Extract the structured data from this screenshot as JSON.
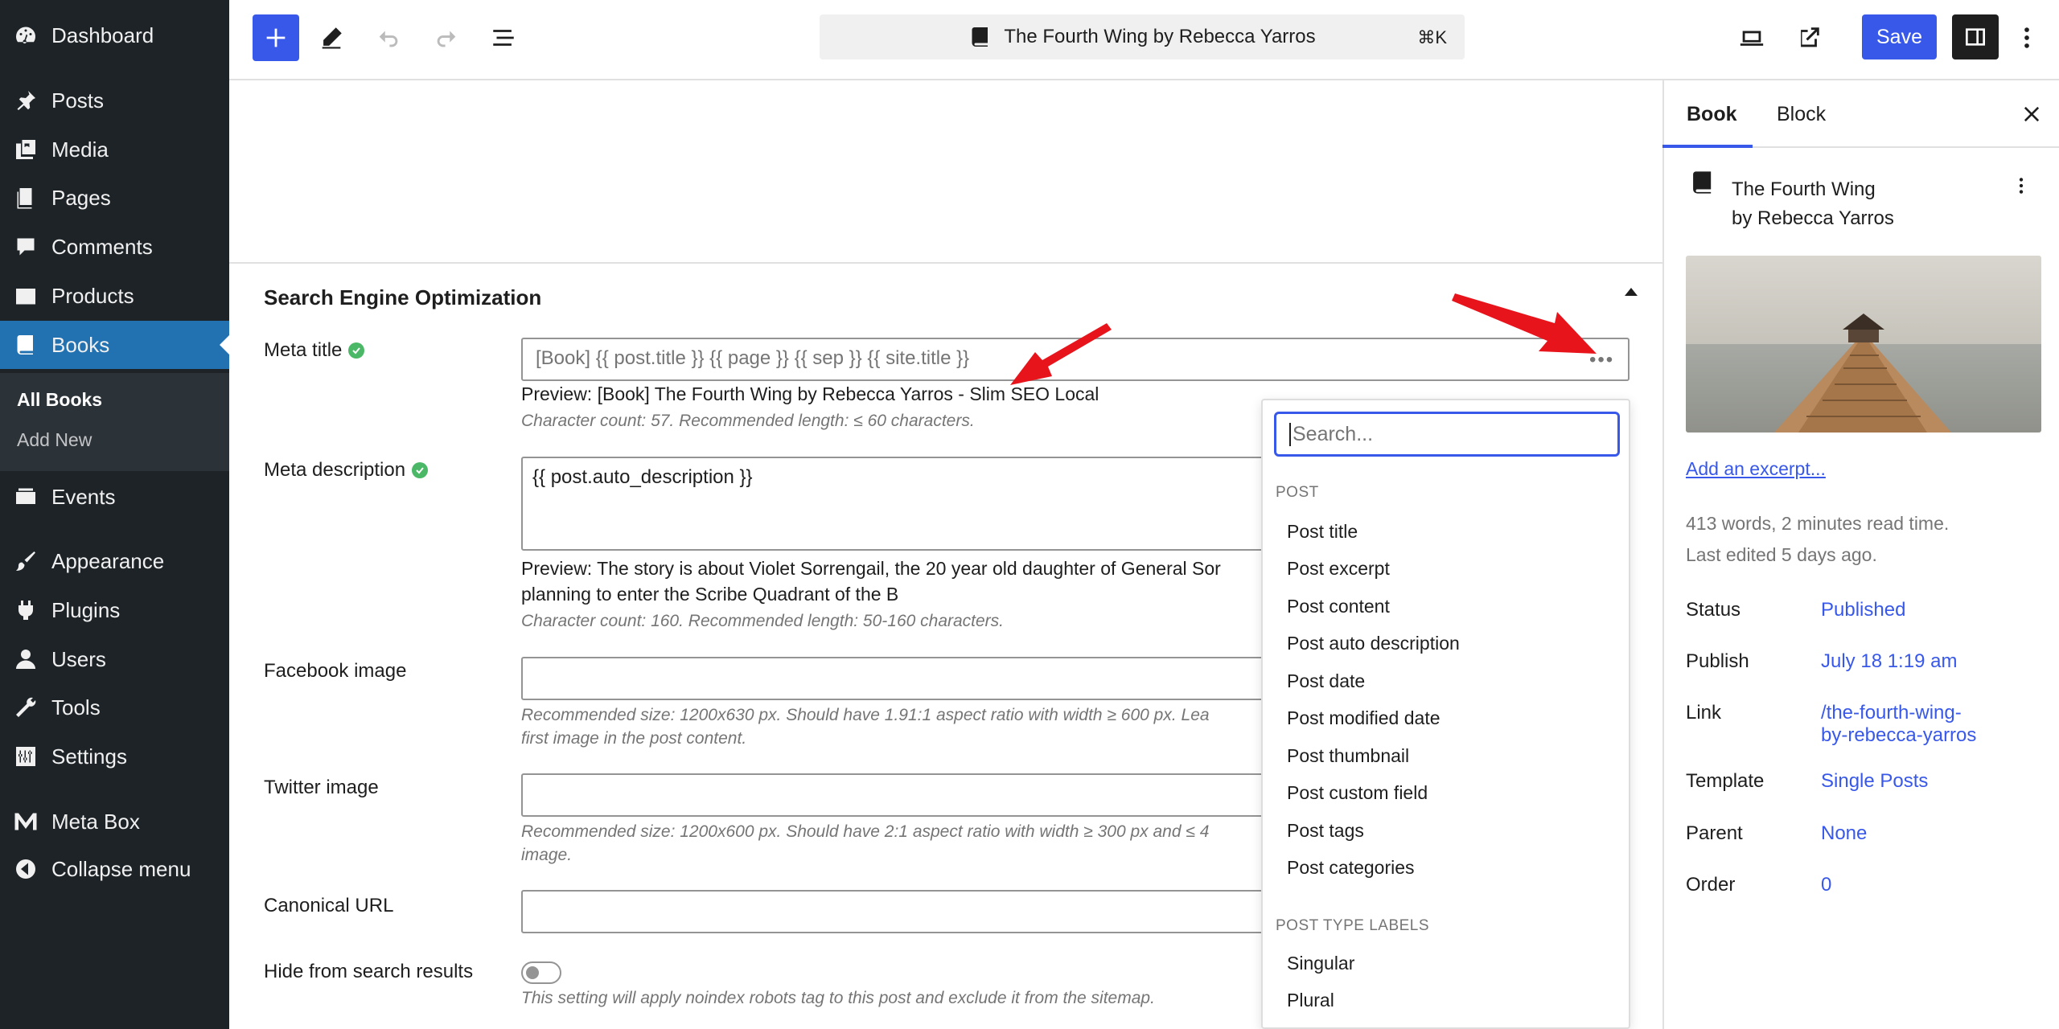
{
  "admin_menu": {
    "items": [
      {
        "label": "Dashboard"
      },
      {
        "label": "Posts"
      },
      {
        "label": "Media"
      },
      {
        "label": "Pages"
      },
      {
        "label": "Comments"
      },
      {
        "label": "Products"
      },
      {
        "label": "Books"
      },
      {
        "label": "Events"
      },
      {
        "label": "Appearance"
      },
      {
        "label": "Plugins"
      },
      {
        "label": "Users"
      },
      {
        "label": "Tools"
      },
      {
        "label": "Settings"
      },
      {
        "label": "Meta Box"
      },
      {
        "label": "Collapse menu"
      }
    ],
    "submenu": [
      {
        "label": "All Books"
      },
      {
        "label": "Add New"
      }
    ]
  },
  "toolbar": {
    "document_title": "The Fourth Wing by Rebecca Yarros",
    "shortcut": "⌘K",
    "save_label": "Save"
  },
  "seo": {
    "section_title": "Search Engine Optimization",
    "meta_title": {
      "label": "Meta title",
      "value": "[Book] {{ post.title }} {{ page }} {{ sep }} {{ site.title }}",
      "preview": "Preview: [Book] The Fourth Wing by Rebecca Yarros - Slim SEO Local",
      "hint": "Character count: 57. Recommended length: ≤ 60 characters."
    },
    "meta_description": {
      "label": "Meta description",
      "value": "{{ post.auto_description }}",
      "preview_line1": "Preview: The story is about Violet Sorrengail, the 20 year old daughter of General Sor",
      "preview_line2": "planning to enter the Scribe Quadrant of the B",
      "hint": "Character count: 160. Recommended length: 50-160 characters."
    },
    "facebook_image": {
      "label": "Facebook image",
      "hint_line1": "Recommended size: 1200x630 px. Should have 1.91:1 aspect ratio with width ≥ 600 px. Lea",
      "hint_line2": "first image in the post content."
    },
    "twitter_image": {
      "label": "Twitter image",
      "hint_line1": "Recommended size: 1200x600 px. Should have 2:1 aspect ratio with width ≥ 300 px and ≤ 4",
      "hint_line2": "image."
    },
    "canonical_url": {
      "label": "Canonical URL"
    },
    "hide_from_search": {
      "label": "Hide from search results",
      "hint": "This setting will apply noindex robots tag to this post and exclude it from the sitemap."
    }
  },
  "dropdown": {
    "search_placeholder": "Search...",
    "group_post": "Post",
    "post_items": [
      "Post title",
      "Post excerpt",
      "Post content",
      "Post auto description",
      "Post date",
      "Post modified date",
      "Post thumbnail",
      "Post custom field",
      "Post tags",
      "Post categories"
    ],
    "group_labels": "Post type labels",
    "label_items": [
      "Singular",
      "Plural"
    ]
  },
  "sidebar": {
    "tabs": [
      "Book",
      "Block"
    ],
    "post_title_line1": "The Fourth Wing",
    "post_title_line2": "by Rebecca Yarros",
    "excerpt_link": "Add an excerpt...",
    "stats_line1": "413 words, 2 minutes read time.",
    "stats_line2": "Last edited 5 days ago.",
    "rows": [
      {
        "label": "Status",
        "value": "Published"
      },
      {
        "label": "Publish",
        "value": "July 18 1:19 am"
      },
      {
        "label": "Link",
        "value_line1": "/the-fourth-wing-",
        "value_line2": "by-rebecca-yarros"
      },
      {
        "label": "Template",
        "value": "Single Posts"
      },
      {
        "label": "Parent",
        "value": "None"
      },
      {
        "label": "Order",
        "value": "0"
      }
    ]
  },
  "colors": {
    "accent": "#3858e9",
    "admin_bg": "#1d2327",
    "admin_current": "#2271b1",
    "success": "#4ab866",
    "arrow": "#e8141c"
  }
}
